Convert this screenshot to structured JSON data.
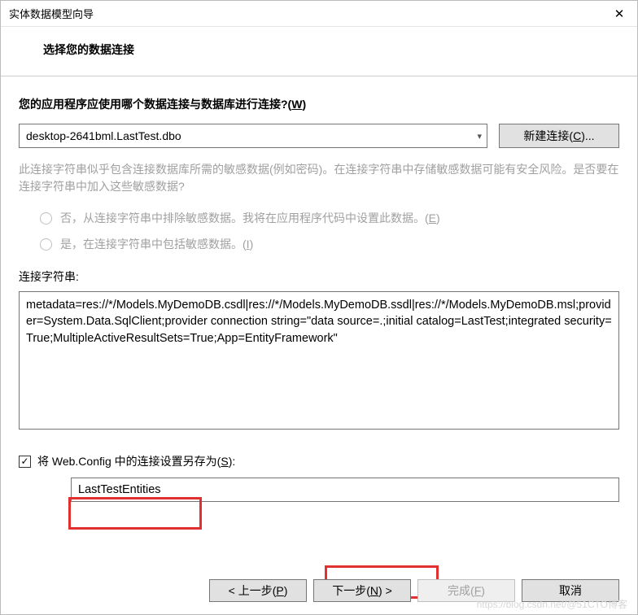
{
  "titlebar": {
    "title": "实体数据模型向导"
  },
  "header": {
    "title": "选择您的数据连接"
  },
  "question": {
    "text_prefix": "您的应用程序应使用哪个数据连接与数据库进行连接?(",
    "accel": "W",
    "text_suffix": ")"
  },
  "connection": {
    "selected": "desktop-2641bml.LastTest.dbo",
    "new_btn_prefix": "新建连接(",
    "new_btn_accel": "C",
    "new_btn_suffix": ")..."
  },
  "info": "此连接字符串似乎包含连接数据库所需的敏感数据(例如密码)。在连接字符串中存储敏感数据可能有安全风险。是否要在连接字符串中加入这些敏感数据?",
  "radio_no": {
    "prefix": "否，从连接字符串中排除敏感数据。我将在应用程序代码中设置此数据。(",
    "accel": "E",
    "suffix": ")"
  },
  "radio_yes": {
    "prefix": "是，在连接字符串中包括敏感数据。(",
    "accel": "I",
    "suffix": ")"
  },
  "cs_label": "连接字符串:",
  "cs_value": "metadata=res://*/Models.MyDemoDB.csdl|res://*/Models.MyDemoDB.ssdl|res://*/Models.MyDemoDB.msl;provider=System.Data.SqlClient;provider connection string=\"data source=.;initial catalog=LastTest;integrated security=True;MultipleActiveResultSets=True;App=EntityFramework\"",
  "save": {
    "checked": "✓",
    "prefix": "将 Web.Config 中的连接设置另存为(",
    "accel": "S",
    "suffix": "):"
  },
  "name_value": "LastTestEntities",
  "buttons": {
    "prev_prefix": "< 上一步(",
    "prev_accel": "P",
    "prev_suffix": ")",
    "next_prefix": "下一步(",
    "next_accel": "N",
    "next_suffix": ") >",
    "finish_prefix": "完成(",
    "finish_accel": "F",
    "finish_suffix": ")",
    "cancel": "取消"
  },
  "watermark": "https://blog.csdn.net/@51CTO博客"
}
